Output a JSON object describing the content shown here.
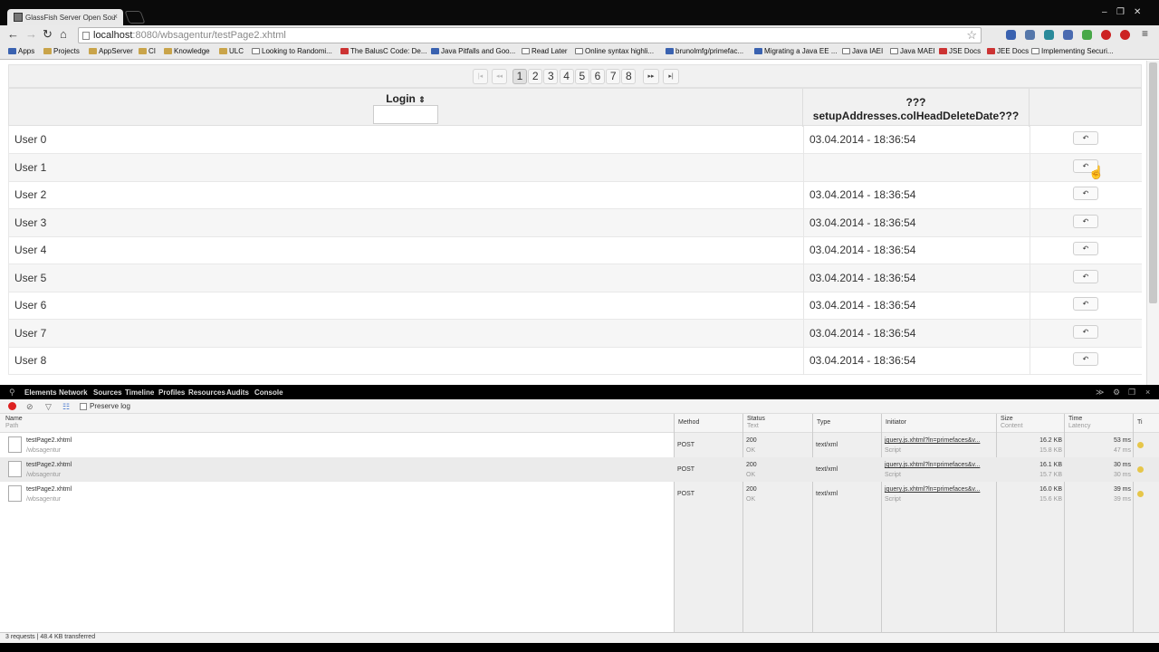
{
  "browser": {
    "tab_title": "GlassFish Server Open Sou",
    "url_host": "localhost",
    "url_rest": ":8080/wbsagentur/testPage2.xhtml",
    "win_controls": [
      "–",
      "❐",
      "✕"
    ],
    "nav": {
      "back": "←",
      "forward": "→",
      "reload": "↻",
      "home": "⌂"
    },
    "star": "☆",
    "extension_colors": [
      "#3a62b0",
      "#5577aa",
      "#2a8a9a",
      "#4a6ab0",
      "#48a848",
      "#c22",
      "#c22"
    ]
  },
  "bookmarks": [
    {
      "label": "Apps",
      "icon": "apps-icon"
    },
    {
      "label": "Projects",
      "icon": "folder"
    },
    {
      "label": "AppServer",
      "icon": "folder"
    },
    {
      "label": "CI",
      "icon": "folder"
    },
    {
      "label": "Knowledge",
      "icon": "folder"
    },
    {
      "label": "ULC",
      "icon": "folder"
    },
    {
      "label": "Looking to Randomi...",
      "icon": "page"
    },
    {
      "label": "The BalusC Code: De...",
      "icon": "red"
    },
    {
      "label": "Java Pitfalls and Goo...",
      "icon": "blue"
    },
    {
      "label": "Read Later",
      "icon": "page"
    },
    {
      "label": "Online syntax highli...",
      "icon": "page"
    },
    {
      "label": "brunolmfg/primefac...",
      "icon": "blue"
    },
    {
      "label": "Migrating a Java EE ...",
      "icon": "blue"
    },
    {
      "label": "Java IAEI",
      "icon": "page"
    },
    {
      "label": "Java MAEI",
      "icon": "page"
    },
    {
      "label": "JSE Docs",
      "icon": "red"
    },
    {
      "label": "JEE Docs",
      "icon": "red"
    },
    {
      "label": "Implementing Securi...",
      "icon": "page"
    }
  ],
  "paginator": {
    "first": "|◂",
    "prev": "◂◂",
    "pages": [
      "1",
      "2",
      "3",
      "4",
      "5",
      "6",
      "7",
      "8"
    ],
    "current": "1",
    "next": "▸▸",
    "last": "▸|"
  },
  "table": {
    "col_login": "Login",
    "sort_icon": "⇕",
    "col_delete_line1": "???",
    "col_delete_line2": "setupAddresses.colHeadDeleteDate???",
    "row_button": "↶",
    "rows": [
      {
        "login": "User 0",
        "date": "03.04.2014 - 18:36:54"
      },
      {
        "login": "User 1",
        "date": ""
      },
      {
        "login": "User 2",
        "date": "03.04.2014 - 18:36:54"
      },
      {
        "login": "User 3",
        "date": "03.04.2014 - 18:36:54"
      },
      {
        "login": "User 4",
        "date": "03.04.2014 - 18:36:54"
      },
      {
        "login": "User 5",
        "date": "03.04.2014 - 18:36:54"
      },
      {
        "login": "User 6",
        "date": "03.04.2014 - 18:36:54"
      },
      {
        "login": "User 7",
        "date": "03.04.2014 - 18:36:54"
      },
      {
        "login": "User 8",
        "date": "03.04.2014 - 18:36:54"
      }
    ]
  },
  "devtools": {
    "tabs": [
      "Elements",
      "Network",
      "Sources",
      "Timeline",
      "Profiles",
      "Resources",
      "Audits",
      "Console"
    ],
    "preserve_log": "Preserve log",
    "columns": {
      "name": "Name",
      "path": "Path",
      "method": "Method",
      "status": "Status",
      "status_sub": "Text",
      "type": "Type",
      "initiator": "Initiator",
      "size": "Size",
      "size_sub": "Content",
      "time": "Time",
      "time_sub": "Latency",
      "timeline": "Ti"
    },
    "requests": [
      {
        "name": "testPage2.xhtml",
        "path": "/wbsagentur",
        "method": "POST",
        "status": "200",
        "status_text": "OK",
        "type": "text/xml",
        "initiator": "jquery.js.xhtml?ln=primefaces&v...",
        "initiator_type": "Script",
        "size": "16.2 KB",
        "content": "15.8 KB",
        "time": "53 ms",
        "latency": "47 ms"
      },
      {
        "name": "testPage2.xhtml",
        "path": "/wbsagentur",
        "method": "POST",
        "status": "200",
        "status_text": "OK",
        "type": "text/xml",
        "initiator": "jquery.js.xhtml?ln=primefaces&v...",
        "initiator_type": "Script",
        "size": "16.1 KB",
        "content": "15.7 KB",
        "time": "30 ms",
        "latency": "30 ms"
      },
      {
        "name": "testPage2.xhtml",
        "path": "/wbsagentur",
        "method": "POST",
        "status": "200",
        "status_text": "OK",
        "type": "text/xml",
        "initiator": "jquery.js.xhtml?ln=primefaces&v...",
        "initiator_type": "Script",
        "size": "16.0 KB",
        "content": "15.6 KB",
        "time": "39 ms",
        "latency": "39 ms"
      }
    ],
    "status_bar": "3 requests | 48.4 KB transferred"
  }
}
